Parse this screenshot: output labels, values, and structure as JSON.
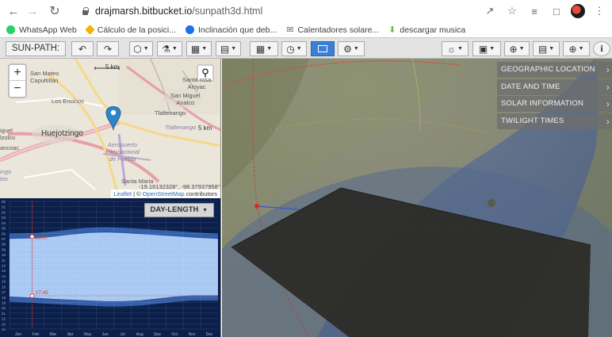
{
  "browser": {
    "url_host": "drajmarsh.bitbucket.io",
    "url_path": "/sunpath3d.html",
    "bookmarks": [
      {
        "label": "WhatsApp Web",
        "color": "#25d366"
      },
      {
        "label": "Cálculo de la posici...",
        "color": "#f4b400"
      },
      {
        "label": "Inclinación que deb...",
        "color": "#1a73e8"
      },
      {
        "label": "Calentadores solare...",
        "color": "#5f6368"
      },
      {
        "label": "descargar musica",
        "color": "#7cb342"
      }
    ]
  },
  "toolbar": {
    "title": "SUN-PATH:",
    "icons": [
      "undo-icon",
      "redo-icon",
      "model-icon",
      "location-icon",
      "grid-icon",
      "shading-icon",
      "calendar-icon",
      "clock-icon",
      "frame-icon",
      "settings-icon",
      "view-icon",
      "display-icon",
      "globe-icon",
      "chart-icon",
      "world-icon",
      "info-icon"
    ]
  },
  "map": {
    "scale_top": "5 km",
    "scale_side": "5 km",
    "labels": {
      "san_mateo": "San Mateo\nCapultitlán",
      "santa_rosa": "Santa rosa\nAtoyac",
      "san_miguel": "San Miguel\nAnalco",
      "los_encinos": "Los Encinos",
      "tlaltenango": "Tlaltenango",
      "tlaltenango_it": "Tlaltenango",
      "huejotzingo": "Huejotzingo",
      "aeropuerto": "Aeropuerto\nInternacional\nde Puebla",
      "left_cut_1": "iguel\nlzolco",
      "left_cut_2": "ancoac",
      "left_cut_3": "ingo\ntos",
      "santa_maria": "Santa Maria"
    },
    "coords": "-19.16132328°, -98.37937958°",
    "attribution_leaflet": "Leaflet",
    "attribution_sep": " | © ",
    "attribution_osm": "OpenStreetMap",
    "attribution_tail": " contributors"
  },
  "chart_data": {
    "type": "area",
    "title": "",
    "hours": [
      "00",
      "01",
      "02",
      "03",
      "04",
      "05",
      "06",
      "07",
      "08",
      "09",
      "10",
      "11",
      "12",
      "13",
      "14",
      "15",
      "16",
      "17",
      "18",
      "19",
      "20",
      "21",
      "22",
      "23",
      "24"
    ],
    "months": [
      "Jan",
      "Feb",
      "Mar",
      "Apr",
      "May",
      "Jun",
      "Jul",
      "Aug",
      "Sep",
      "Oct",
      "Nov",
      "Dec"
    ],
    "sunrise": [
      6.95,
      6.85,
      6.55,
      6.15,
      5.85,
      5.75,
      5.85,
      6.05,
      6.25,
      6.45,
      6.7,
      6.95
    ],
    "sunset": [
      17.95,
      18.2,
      18.4,
      18.55,
      18.7,
      18.85,
      18.85,
      18.7,
      18.35,
      18.0,
      17.75,
      17.75
    ],
    "cursor_month_index": 1.3,
    "sunrise_label": "06:37",
    "sunset_label": "17:45",
    "button_label": "DAY-LENGTH",
    "background": "#0b1f4b",
    "daylight_color": "#a9c9f3"
  },
  "view3d": {
    "menu": [
      "GEOGRAPHIC LOCATION",
      "DATE AND TIME",
      "SOLAR INFORMATION",
      "TWILIGHT TIMES"
    ]
  }
}
